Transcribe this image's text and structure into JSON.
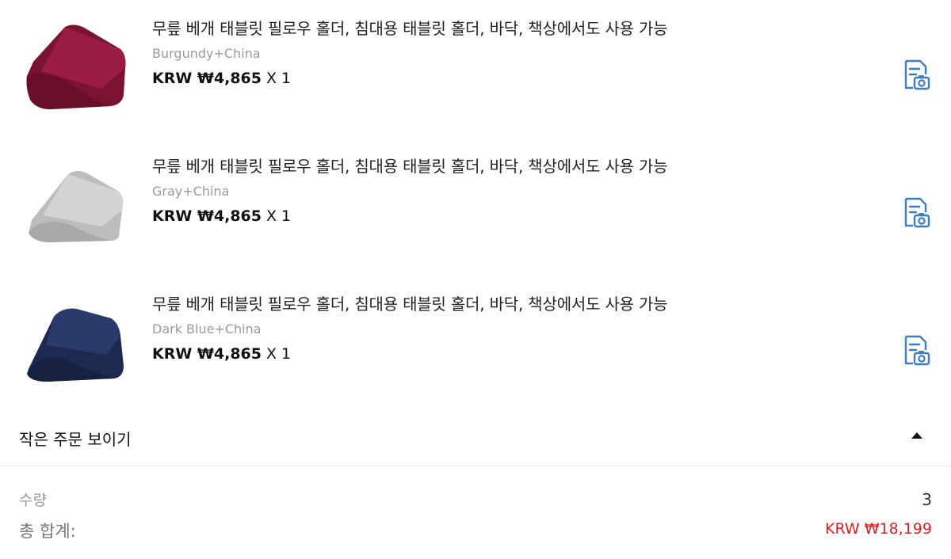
{
  "items": [
    {
      "title": "무릎 베개 태블릿 필로우 홀더, 침대용 태블릿 홀더, 바닥, 책상에서도 사용 가능",
      "variant": "Burgundy+China",
      "price": "KRW ₩4,865",
      "qty": "X 1",
      "image_color": "#8a1a3a",
      "image_icon": "pillow-stand-burgundy",
      "action_icon": "receipt-camera-icon"
    },
    {
      "title": "무릎 베개 태블릿 필로우 홀더, 침대용 태블릿 홀더, 바닥, 책상에서도 사용 가능",
      "variant": "Gray+China",
      "price": "KRW ₩4,865",
      "qty": "X 1",
      "image_color": "#c8c8c8",
      "image_icon": "pillow-stand-gray",
      "action_icon": "receipt-camera-icon"
    },
    {
      "title": "무릎 베개 태블릿 필로우 홀더, 침대용 태블릿 홀더, 바닥, 책상에서도 사용 가능",
      "variant": "Dark Blue+China",
      "price": "KRW ₩4,865",
      "qty": "X 1",
      "image_color": "#1f2d55",
      "image_icon": "pillow-stand-dark-blue",
      "action_icon": "receipt-camera-icon"
    }
  ],
  "toggle": {
    "label": "작은 주문 보이기",
    "icon": "caret-up-icon"
  },
  "summary": {
    "quantity_label": "수량",
    "quantity_value": "3",
    "total_label": "총 합계:",
    "total_value": "KRW ₩18,199"
  },
  "colors": {
    "accent_blue": "#3a7fc4",
    "total_red": "#e02020",
    "muted_text": "#9a9a9a"
  }
}
